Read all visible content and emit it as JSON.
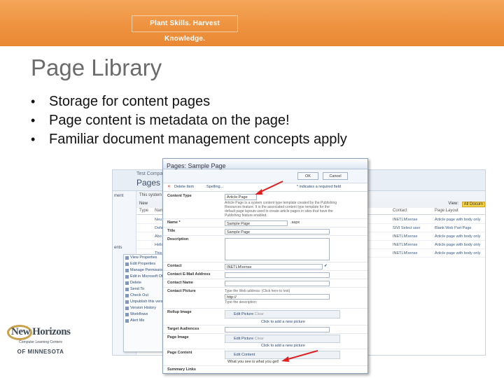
{
  "banner": {
    "tagline": "Plant Skills. Harvest Knowledge."
  },
  "slide": {
    "title": "Page Library",
    "bullets": [
      "Storage for content pages",
      "Page content is metadata on the page!",
      "Familiar document management concepts apply"
    ],
    "bullet_glyph": "•"
  },
  "library": {
    "crumb": "Test Compan",
    "title": "Pages",
    "left_nav": [
      "ment",
      "",
      "",
      "ents"
    ],
    "headers": [
      "New",
      "Actions",
      "This system li"
    ],
    "view_label": "View:",
    "view_value": "All Docum",
    "columns": [
      "Type",
      "Nam",
      "Contact",
      "Page Layout"
    ],
    "rows": [
      {
        "name": "Neu",
        "contact": "INETLM\\rense",
        "layout": "Article page with body only"
      },
      {
        "name": "Defa",
        "contact": "SIVI Select user",
        "layout": "Blank Web Part Page"
      },
      {
        "name": "Abo",
        "contact": "INETLM\\rense",
        "layout": "Article page with body only"
      },
      {
        "name": "Hello",
        "contact": "INETLM\\rense",
        "layout": "Article page with body only"
      },
      {
        "name": "This",
        "contact": "INETLM\\rense",
        "layout": "Article page with body only"
      }
    ]
  },
  "context_menu": [
    "View Properties",
    "Edit Properties",
    "Manage Permissions",
    "Edit in Microsoft Of",
    "Delete",
    "Send To",
    "Check Out",
    "Unpublish this versio",
    "Version History",
    "Workflows",
    "Alert Me"
  ],
  "dialog": {
    "title": "Pages: Sample Page",
    "ok": "OK",
    "cancel": "Cancel",
    "delete_item": "Delete Item",
    "spelling": "Spelling...",
    "required_note": "* indicates a required field",
    "fields": {
      "content_type": {
        "label": "Content Type",
        "value": "Article Page",
        "note": "Article Page is a system content type template created by the Publishing Resources feature. It is the associated content type template for the default page layouts used to create article pages in sites that have the Publishing feature enabled."
      },
      "name": {
        "label": "Name *",
        "value": "Sample Page",
        "suffix": ".aspx"
      },
      "title": {
        "label": "Title",
        "value": "Sample Page"
      },
      "description": {
        "label": "Description"
      },
      "contact": {
        "label": "Contact",
        "value": "INETLM\\rense"
      },
      "contact_email": {
        "label": "Contact E-Mail Address"
      },
      "contact_name": {
        "label": "Contact Name"
      },
      "contact_picture": {
        "label": "Contact Picture",
        "hint1": "Type the Web address: (Click here to test)",
        "url": "http://",
        "hint2": "Type the description:"
      },
      "rollup_image": {
        "label": "Rollup Image",
        "button": "Edit Picture",
        "clear": "Clear",
        "link": "Click to add a new picture"
      },
      "target_audiences": {
        "label": "Target Audiences"
      },
      "page_image": {
        "label": "Page Image",
        "button": "Edit Picture",
        "clear": "Clear",
        "link": "Click to add a new picture"
      },
      "page_content": {
        "label": "Page Content",
        "button": "Edit Content",
        "value": "What you see is what you get!"
      },
      "summary_links": {
        "label": "Summary Links"
      }
    }
  },
  "logo": {
    "name": "New Horizons",
    "sub": "Computer Learning Centers",
    "state": "OF MINNESOTA"
  },
  "colors": {
    "banner": "#ee9340",
    "arrow": "#e02020",
    "link": "#2b4a76"
  }
}
